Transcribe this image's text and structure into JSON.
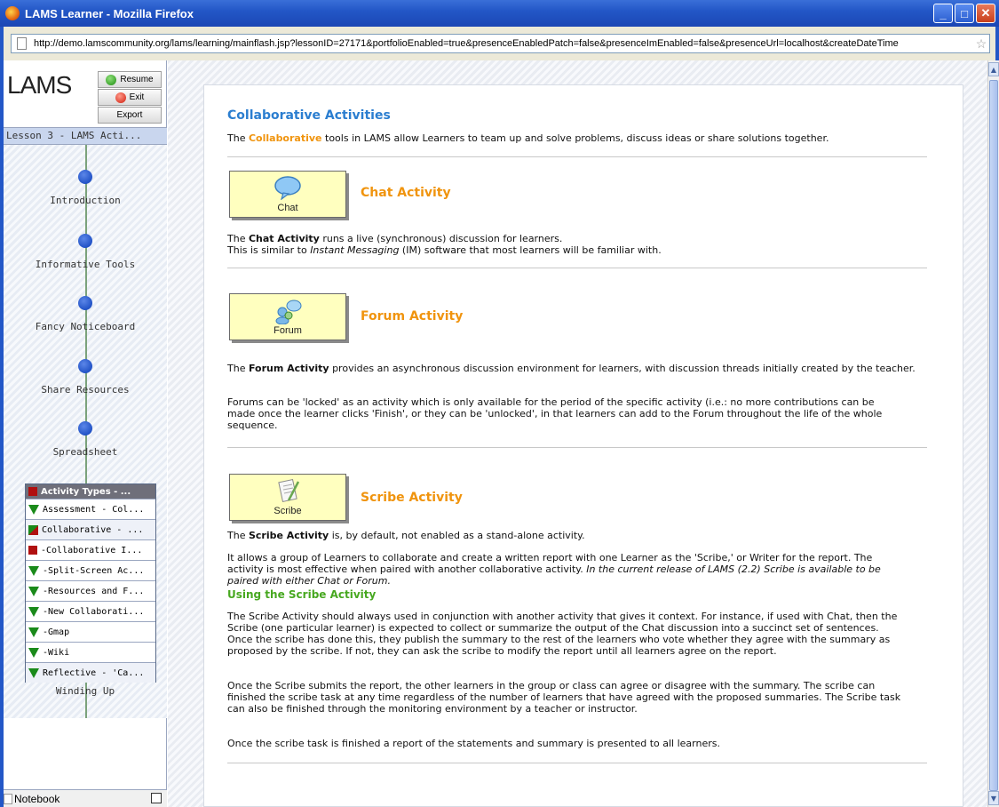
{
  "window": {
    "title": "LAMS Learner - Mozilla Firefox",
    "minimize": "_",
    "maximize": "□",
    "close": "✕"
  },
  "address": {
    "url": "http://demo.lamscommunity.org/lams/learning/mainflash.jsp?lessonID=27171&portfolioEnabled=true&presenceEnabledPatch=false&presenceImEnabled=false&presenceUrl=localhost&createDateTime"
  },
  "sidebar": {
    "logo": "LAMS",
    "resume_label": "Resume",
    "exit_label": "Exit",
    "export_label": "Export",
    "lesson_title": "Lesson 3 - LAMS Acti...",
    "nodes": [
      {
        "label": "Introduction"
      },
      {
        "label": "Informative Tools"
      },
      {
        "label": "Fancy Noticeboard"
      },
      {
        "label": "Share Resources"
      },
      {
        "label": "Spreadsheet"
      }
    ],
    "optional_header": "Activity Types - ...",
    "optional_items": [
      {
        "label": "Assessment - Col...",
        "marker": "tri-green"
      },
      {
        "label": "Collaborative - ...",
        "marker": "sq-mixed"
      },
      {
        "label": "-Collaborative I...",
        "marker": "sq-red"
      },
      {
        "label": "-Split-Screen Ac...",
        "marker": "tri-green"
      },
      {
        "label": "-Resources and F...",
        "marker": "tri-green"
      },
      {
        "label": "-New Collaborati...",
        "marker": "tri-green"
      },
      {
        "label": "-Gmap",
        "marker": "tri-green"
      },
      {
        "label": "-Wiki",
        "marker": "tri-green"
      },
      {
        "label": "Reflective - 'Ca...",
        "marker": "tri-green"
      }
    ],
    "last_node": "Winding Up",
    "notebook_label": "Notebook"
  },
  "content": {
    "heading": "Collaborative Activities",
    "intro_pre": "The ",
    "intro_highlight": "Collaborative",
    "intro_post": " tools in LAMS allow Learners to team up and solve problems, discuss ideas or share solutions together.",
    "chat": {
      "button_label": "Chat",
      "title": "Chat Activity",
      "line1_pre": "The ",
      "line1_bold": "Chat Activity",
      "line1_post": " runs a live (synchronous) discussion for learners.",
      "line2_pre": "This is similar to ",
      "line2_italic": "Instant Messaging",
      "line2_post": " (IM) software that most learners will be familiar with."
    },
    "forum": {
      "button_label": "Forum",
      "title": "Forum Activity",
      "p1_pre": " The ",
      "p1_bold": "Forum Activity",
      "p1_post": " provides an asynchronous discussion environment for learners, with discussion threads initially created by the teacher.",
      "p2": "Forums can be 'locked' as an activity which is only available for the period of the specific activity (i.e.: no more contributions can be made once the learner clicks 'Finish', or they can be 'unlocked', in that learners can add to the Forum throughout the life of the whole sequence."
    },
    "scribe": {
      "button_label": "Scribe",
      "title": "Scribe Activity",
      "p1_pre": " The ",
      "p1_bold": "Scribe Activity",
      "p1_post": " is, by default, not enabled as a stand-alone activity.",
      "p2_pre": "It allows a group of Learners to collaborate and create a written report with one Learner as the 'Scribe,' or Writer for the report. The activity is most effective when paired with another collaborative activity. ",
      "p2_italic": "In the current release of LAMS (2.2) Scribe is available to be paired with either Chat or Forum.",
      "subheading": "Using the Scribe Activity",
      "p3": "The Scribe Activity should always used in conjunction with another activity that gives it context. For instance, if used with Chat, then the Scribe (one particular learner) is expected to collect or summarize the output of the Chat discussion into a succinct set of sentences. Once the scribe has done this, they publish the summary to the rest of the learners who vote whether they agree with the summary as proposed by the scribe. If not, they can ask the scribe to modify the report until all learners agree on the report.",
      "p4": "Once the Scribe submits the report, the other learners in the group or class can agree or disagree with the summary. The scribe can finished the scribe task at any time regardless of the number of learners that have agreed with the proposed summaries. The Scribe task can also be finished through the monitoring environment by a teacher or instructor.",
      "p5": "Once the scribe task is finished a report of the statements and summary is presented to all learners."
    }
  }
}
